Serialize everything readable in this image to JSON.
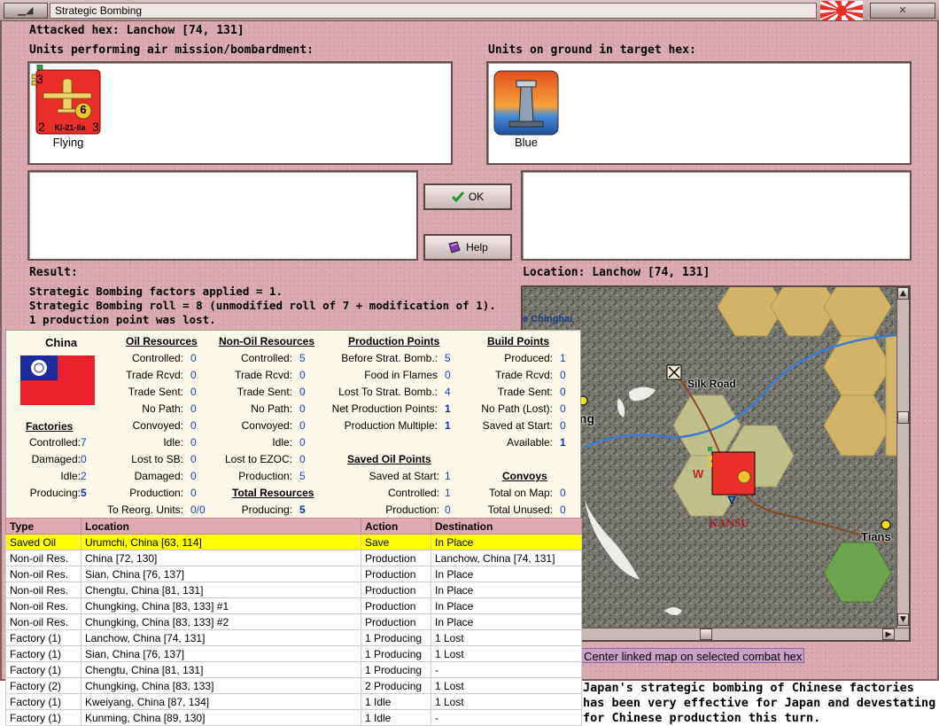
{
  "window": {
    "title": "Strategic Bombing"
  },
  "attacked_hex": "Attacked hex: Lanchow  [74, 131]",
  "air_units": {
    "label": "Units performing air mission/bombardment:",
    "units": [
      {
        "name": "KI-21-IIa",
        "status": "Flying",
        "top_left": "3",
        "bottom_left": "2",
        "bottom_right": "3",
        "badge": "6"
      }
    ]
  },
  "ground_units": {
    "label": "Units on ground in target hex:",
    "units": [
      {
        "status": "Blue"
      }
    ]
  },
  "buttons": {
    "ok": "OK",
    "help": "Help"
  },
  "result": {
    "label": "Result:",
    "lines": [
      "Strategic Bombing factors applied = 1.",
      "Strategic Bombing roll = 8 (unmodified roll of 7 + modification of 1).",
      "1 production point was lost."
    ]
  },
  "location": {
    "label": "Location:  Lanchow  [74, 131]"
  },
  "map": {
    "labels": {
      "silk_road": "Silk Road",
      "kansu": "KANSU",
      "tians": "Tians",
      "ching": "ing",
      "chinghai": "e Chinghai",
      "w": "W"
    },
    "center_link": "Center linked map on selected combat hex"
  },
  "report": {
    "country": "China",
    "factories": {
      "heading": "Factories",
      "rows": [
        {
          "label": "Controlled:",
          "value": "7"
        },
        {
          "label": "Damaged:",
          "value": "0"
        },
        {
          "label": "Idle:",
          "value": "2"
        },
        {
          "label": "Producing:",
          "value": "5",
          "bold": true
        }
      ]
    },
    "oil": {
      "heading": "Oil Resources",
      "rows": [
        {
          "label": "Controlled:",
          "value": "0"
        },
        {
          "label": "Trade Rcvd:",
          "value": "0"
        },
        {
          "label": "Trade Sent:",
          "value": "0"
        },
        {
          "label": "No Path:",
          "value": "0"
        },
        {
          "label": "Convoyed:",
          "value": "0"
        },
        {
          "label": "Idle:",
          "value": "0"
        },
        {
          "label": "Lost to SB:",
          "value": "0"
        },
        {
          "label": "Damaged:",
          "value": "0"
        },
        {
          "label": "Production:",
          "value": "0"
        },
        {
          "label": "To Reorg. Units:",
          "value": "0/0"
        }
      ]
    },
    "non_oil": {
      "heading": "Non-Oil Resources",
      "rows": [
        {
          "label": "Controlled:",
          "value": "5"
        },
        {
          "label": "Trade Rcvd:",
          "value": "0"
        },
        {
          "label": "Trade Sent:",
          "value": "0"
        },
        {
          "label": "No Path:",
          "value": "0"
        },
        {
          "label": "Convoyed:",
          "value": "0"
        },
        {
          "label": "Idle:",
          "value": "0"
        },
        {
          "label": "Lost to EZOC:",
          "value": "0"
        },
        {
          "label": "Production:",
          "value": "5"
        }
      ]
    },
    "total_resources": {
      "heading": "Total Resources",
      "rows": [
        {
          "label": "Producing:",
          "value": "5",
          "bold": true
        }
      ]
    },
    "production_points": {
      "heading": "Production Points",
      "rows": [
        {
          "label": "Before Strat. Bomb.:",
          "value": "5"
        },
        {
          "label": "Food in Flames",
          "value": "0"
        },
        {
          "label": "Lost To Strat. Bomb.:",
          "value": "4"
        },
        {
          "label": "Net Production Points:",
          "value": "1",
          "bold": true
        },
        {
          "label": "Production Multiple:",
          "value": "1",
          "bold": true
        }
      ]
    },
    "saved_oil": {
      "heading": "Saved Oil Points",
      "rows": [
        {
          "label": "Saved at Start:",
          "value": "1"
        },
        {
          "label": "Controlled:",
          "value": "1"
        },
        {
          "label": "Production:",
          "value": "0"
        }
      ]
    },
    "build_points": {
      "heading": "Build Points",
      "rows": [
        {
          "label": "Produced:",
          "value": "1"
        },
        {
          "label": "Trade Rcvd:",
          "value": "0"
        },
        {
          "label": "Trade Sent:",
          "value": "0"
        },
        {
          "label": "No Path (Lost):",
          "value": "0"
        },
        {
          "label": "Saved at Start:",
          "value": "0"
        },
        {
          "label": "Available:",
          "value": "1",
          "bold": true
        }
      ]
    },
    "convoys": {
      "heading": "Convoys",
      "rows": [
        {
          "label": "Total on Map:",
          "value": "0"
        },
        {
          "label": "Total Unused:",
          "value": "0"
        }
      ]
    }
  },
  "table": {
    "columns": [
      "Type",
      "Location",
      "Action",
      "Destination"
    ],
    "rows": [
      [
        "Saved Oil",
        "Urumchi, China [63, 114]",
        "Save",
        "In Place"
      ],
      [
        "Non-oil Res.",
        "China [72, 130]",
        "Production",
        "Lanchow, China [74, 131]"
      ],
      [
        "Non-oil Res.",
        "Sian, China [76, 137]",
        "Production",
        "In Place"
      ],
      [
        "Non-oil Res.",
        "Chengtu, China [81, 131]",
        "Production",
        "In Place"
      ],
      [
        "Non-oil Res.",
        "Chungking, China [83, 133] #1",
        "Production",
        "In Place"
      ],
      [
        "Non-oil Res.",
        "Chungking, China [83, 133] #2",
        "Production",
        "In Place"
      ],
      [
        "Factory (1)",
        "Lanchow, China [74, 131]",
        "1 Producing",
        "1 Lost"
      ],
      [
        "Factory (1)",
        "Sian, China [76, 137]",
        "1 Producing",
        "1 Lost"
      ],
      [
        "Factory (1)",
        "Chengtu, China [81, 131]",
        "1 Producing",
        "-"
      ],
      [
        "Factory (2)",
        "Chungking, China [83, 133]",
        "2 Producing",
        "1 Lost"
      ],
      [
        "Factory (1)",
        "Kweiyang, China [87, 134]",
        "1 Idle",
        "1 Lost"
      ],
      [
        "Factory (1)",
        "Kunming, China [89, 130]",
        "1 Idle",
        "-"
      ]
    ]
  },
  "caption": "Japan's strategic bombing of Chinese factories has been very effective for Japan and devestating for Chinese production this turn."
}
